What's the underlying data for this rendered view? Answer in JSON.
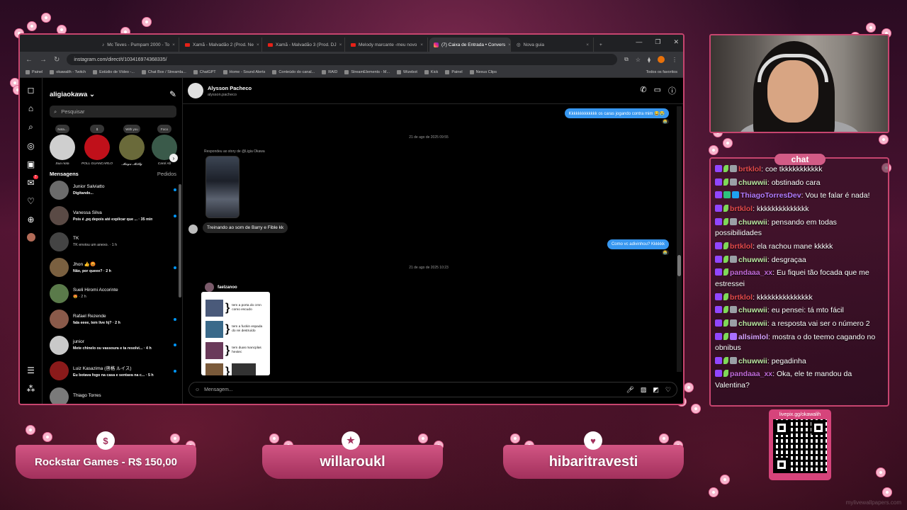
{
  "browser": {
    "tabs": [
      {
        "label": "Mc Teves - Pumpam 2000 - To",
        "icon": "music-icon",
        "active": false
      },
      {
        "label": "Xamã - Malvadão 2 (Prod. Ne",
        "icon": "youtube-icon",
        "active": false
      },
      {
        "label": "Xamã - Malvadão 3 (Prod. DJ",
        "icon": "youtube-icon",
        "active": false
      },
      {
        "label": "Melody marcante -meu novo",
        "icon": "youtube-icon",
        "active": false
      },
      {
        "label": "(7) Caixa de Entrada • Convers",
        "icon": "instagram-icon",
        "active": true
      },
      {
        "label": "Nova guia",
        "icon": "globe-icon",
        "active": false
      }
    ],
    "url": "instagram.com/direct/t/103416974368335/",
    "bookmarks": [
      "Painel",
      "okawalih - Twitch",
      "Estúdio de Vídeo -...",
      "Chat Box / Streamla...",
      "ChatGPT",
      "Home - Sound Alerts",
      "Conteúdo do canal...",
      "RAID",
      "StreamElements - M...",
      "Wizebot",
      "Kick",
      "Painel",
      "Nexus Clips"
    ],
    "bookmarks_right": "Todos os favoritos"
  },
  "ig": {
    "username": "aligiaokawa",
    "search_placeholder": "Pesquisar",
    "rail_badge": "7",
    "notes": [
      {
        "bubble": "Nota...",
        "name": "Sua nota",
        "color": "#cfcfcf"
      },
      {
        "bubble": "$",
        "name": "POLL GUANCARLO",
        "color": "#c0101a"
      },
      {
        "bubble": "With you",
        "name": "𝓜𝓪𝔂𝓪 𝓜𝓲𝓵𝓵𝔂",
        "color": "#6a6a3a"
      },
      {
        "bubble": "Foco",
        "name": "Carol Ab",
        "color": "#3a5a4a"
      }
    ],
    "messages_title": "Mensagens",
    "requests_label": "Pedidos",
    "conversations": [
      {
        "name": "Junior Salviatto",
        "preview": "Digitando...",
        "unread": true,
        "color": "#6b6b6b"
      },
      {
        "name": "Vanessa Silva",
        "preview": "Pois é ,pq depois até explicar que ... · 35 min",
        "unread": true,
        "color": "#5a4a45"
      },
      {
        "name": "TK",
        "preview": "TK enviou um anexo. · 1 h",
        "unread": false,
        "color": "#444"
      },
      {
        "name": "Jhon 👍😡",
        "preview": "Não, por queee? · 2 h",
        "unread": true,
        "color": "#7a6040"
      },
      {
        "name": "Sueli Hiromi Accorinte",
        "preview": "😍 · 2 h",
        "unread": false,
        "color": "#5a7a4a"
      },
      {
        "name": "Rafael Rezende",
        "preview": "fala eeee, tem live hj? · 2 h",
        "unread": true,
        "color": "#8a5a4a"
      },
      {
        "name": "junior",
        "preview": "Mete chinelo ou vassoura e ta resolvi... · 4 h",
        "unread": true,
        "color": "#c9c9c9"
      },
      {
        "name": "Luiz Kasazima (啓格 ルイス)",
        "preview": "Eu botava fogo na casa e sentava na c... · 5 h",
        "unread": true,
        "color": "#8a1a1a"
      },
      {
        "name": "Thiago Torres",
        "preview": "",
        "unread": false,
        "color": "#7a7a7a"
      }
    ],
    "chat": {
      "name": "Alysson Pacheco",
      "handle": "alysson.pacheco",
      "msg_out_1": "Kkkkkkkkkkkkk os caras jogando contra mim 😂😭",
      "date_1": "21 de ago de 2025 09:55",
      "reply_note": "Respondeu ao story de @Ligia Okawa",
      "msg_in_1": "Treinando ao som de Barry e Fible kk",
      "msg_out_2": "Como vc adivinhou? Kkkkkk",
      "date_2": "21 de ago de 2025 10:23",
      "post_author": "faelzanoo",
      "meme_lines": [
        "tem a porta do crnn como escudo",
        "tem a fuckin espada do rei destruído",
        "tem duas mancplas hextec"
      ],
      "composer_placeholder": "Mensagem..."
    }
  },
  "chat_panel": {
    "title": "chat",
    "messages": [
      {
        "user": "brtklol",
        "user_color": "#e34a4a",
        "text": "coe tkkkkkkkkkkk",
        "badges": [
          "b-tw",
          "b-leaf",
          "b-gift"
        ]
      },
      {
        "user": "chuwwii",
        "user_color": "#b7e7a0",
        "text": "obstinado cara",
        "badges": [
          "b-tw",
          "b-leaf",
          "b-gift"
        ]
      },
      {
        "user": "ThiagoTorresDev",
        "user_color": "#b27cff",
        "text": "Vou te falar é nada!",
        "badges": [
          "b-tw",
          "b-sub",
          "b-star"
        ]
      },
      {
        "user": "brtklol",
        "user_color": "#e34a4a",
        "text": "kkkkkkkkkkkkkk",
        "badges": [
          "b-tw",
          "b-leaf"
        ]
      },
      {
        "user": "chuwwii",
        "user_color": "#b7e7a0",
        "text": "pensando em todas possibilidades",
        "badges": [
          "b-tw",
          "b-leaf",
          "b-gift"
        ]
      },
      {
        "user": "brtklol",
        "user_color": "#e34a4a",
        "text": "ela rachou mane kkkkk",
        "badges": [
          "b-tw",
          "b-leaf"
        ]
      },
      {
        "user": "chuwwii",
        "user_color": "#b7e7a0",
        "text": "desgraçaa",
        "badges": [
          "b-tw",
          "b-leaf",
          "b-gift"
        ]
      },
      {
        "user": "pandaaa_xx",
        "user_color": "#c06ad8",
        "text": "Eu fiquei tão focada que me estressei",
        "badges": [
          "b-tw",
          "b-leaf"
        ]
      },
      {
        "user": "brtklol",
        "user_color": "#e34a4a",
        "text": "kkkkkkkkkkkkkkk",
        "badges": [
          "b-tw",
          "b-leaf"
        ]
      },
      {
        "user": "chuwwii",
        "user_color": "#b7e7a0",
        "text": "eu pensei: tá mto fácil",
        "badges": [
          "b-tw",
          "b-leaf",
          "b-gift"
        ]
      },
      {
        "user": "chuwwii",
        "user_color": "#b7e7a0",
        "text": "a resposta vai ser o número 2",
        "badges": [
          "b-tw",
          "b-leaf",
          "b-gift"
        ]
      },
      {
        "user": "allsimlol",
        "user_color": "#d7a3ff",
        "text": "mostra o do teemo cagando no obnibus",
        "badges": [
          "b-tw",
          "b-leaf",
          "b-purp"
        ]
      },
      {
        "user": "chuwwii",
        "user_color": "#b7e7a0",
        "text": "pegadinha",
        "badges": [
          "b-tw",
          "b-leaf",
          "b-gift"
        ]
      },
      {
        "user": "pandaaa_xx",
        "user_color": "#c06ad8",
        "text": "Oka, ele te mandou da Valentina?",
        "badges": [
          "b-tw",
          "b-leaf"
        ]
      }
    ]
  },
  "qr_label": "livepix.gg/okawalih",
  "banners": [
    {
      "text": "Rockstar Games - R$ 150,00",
      "icon": "$"
    },
    {
      "text": "willaroukl",
      "icon": "★"
    },
    {
      "text": "hibaritravesti",
      "icon": "♥"
    }
  ],
  "watermark": "mylivewallpapers.com"
}
